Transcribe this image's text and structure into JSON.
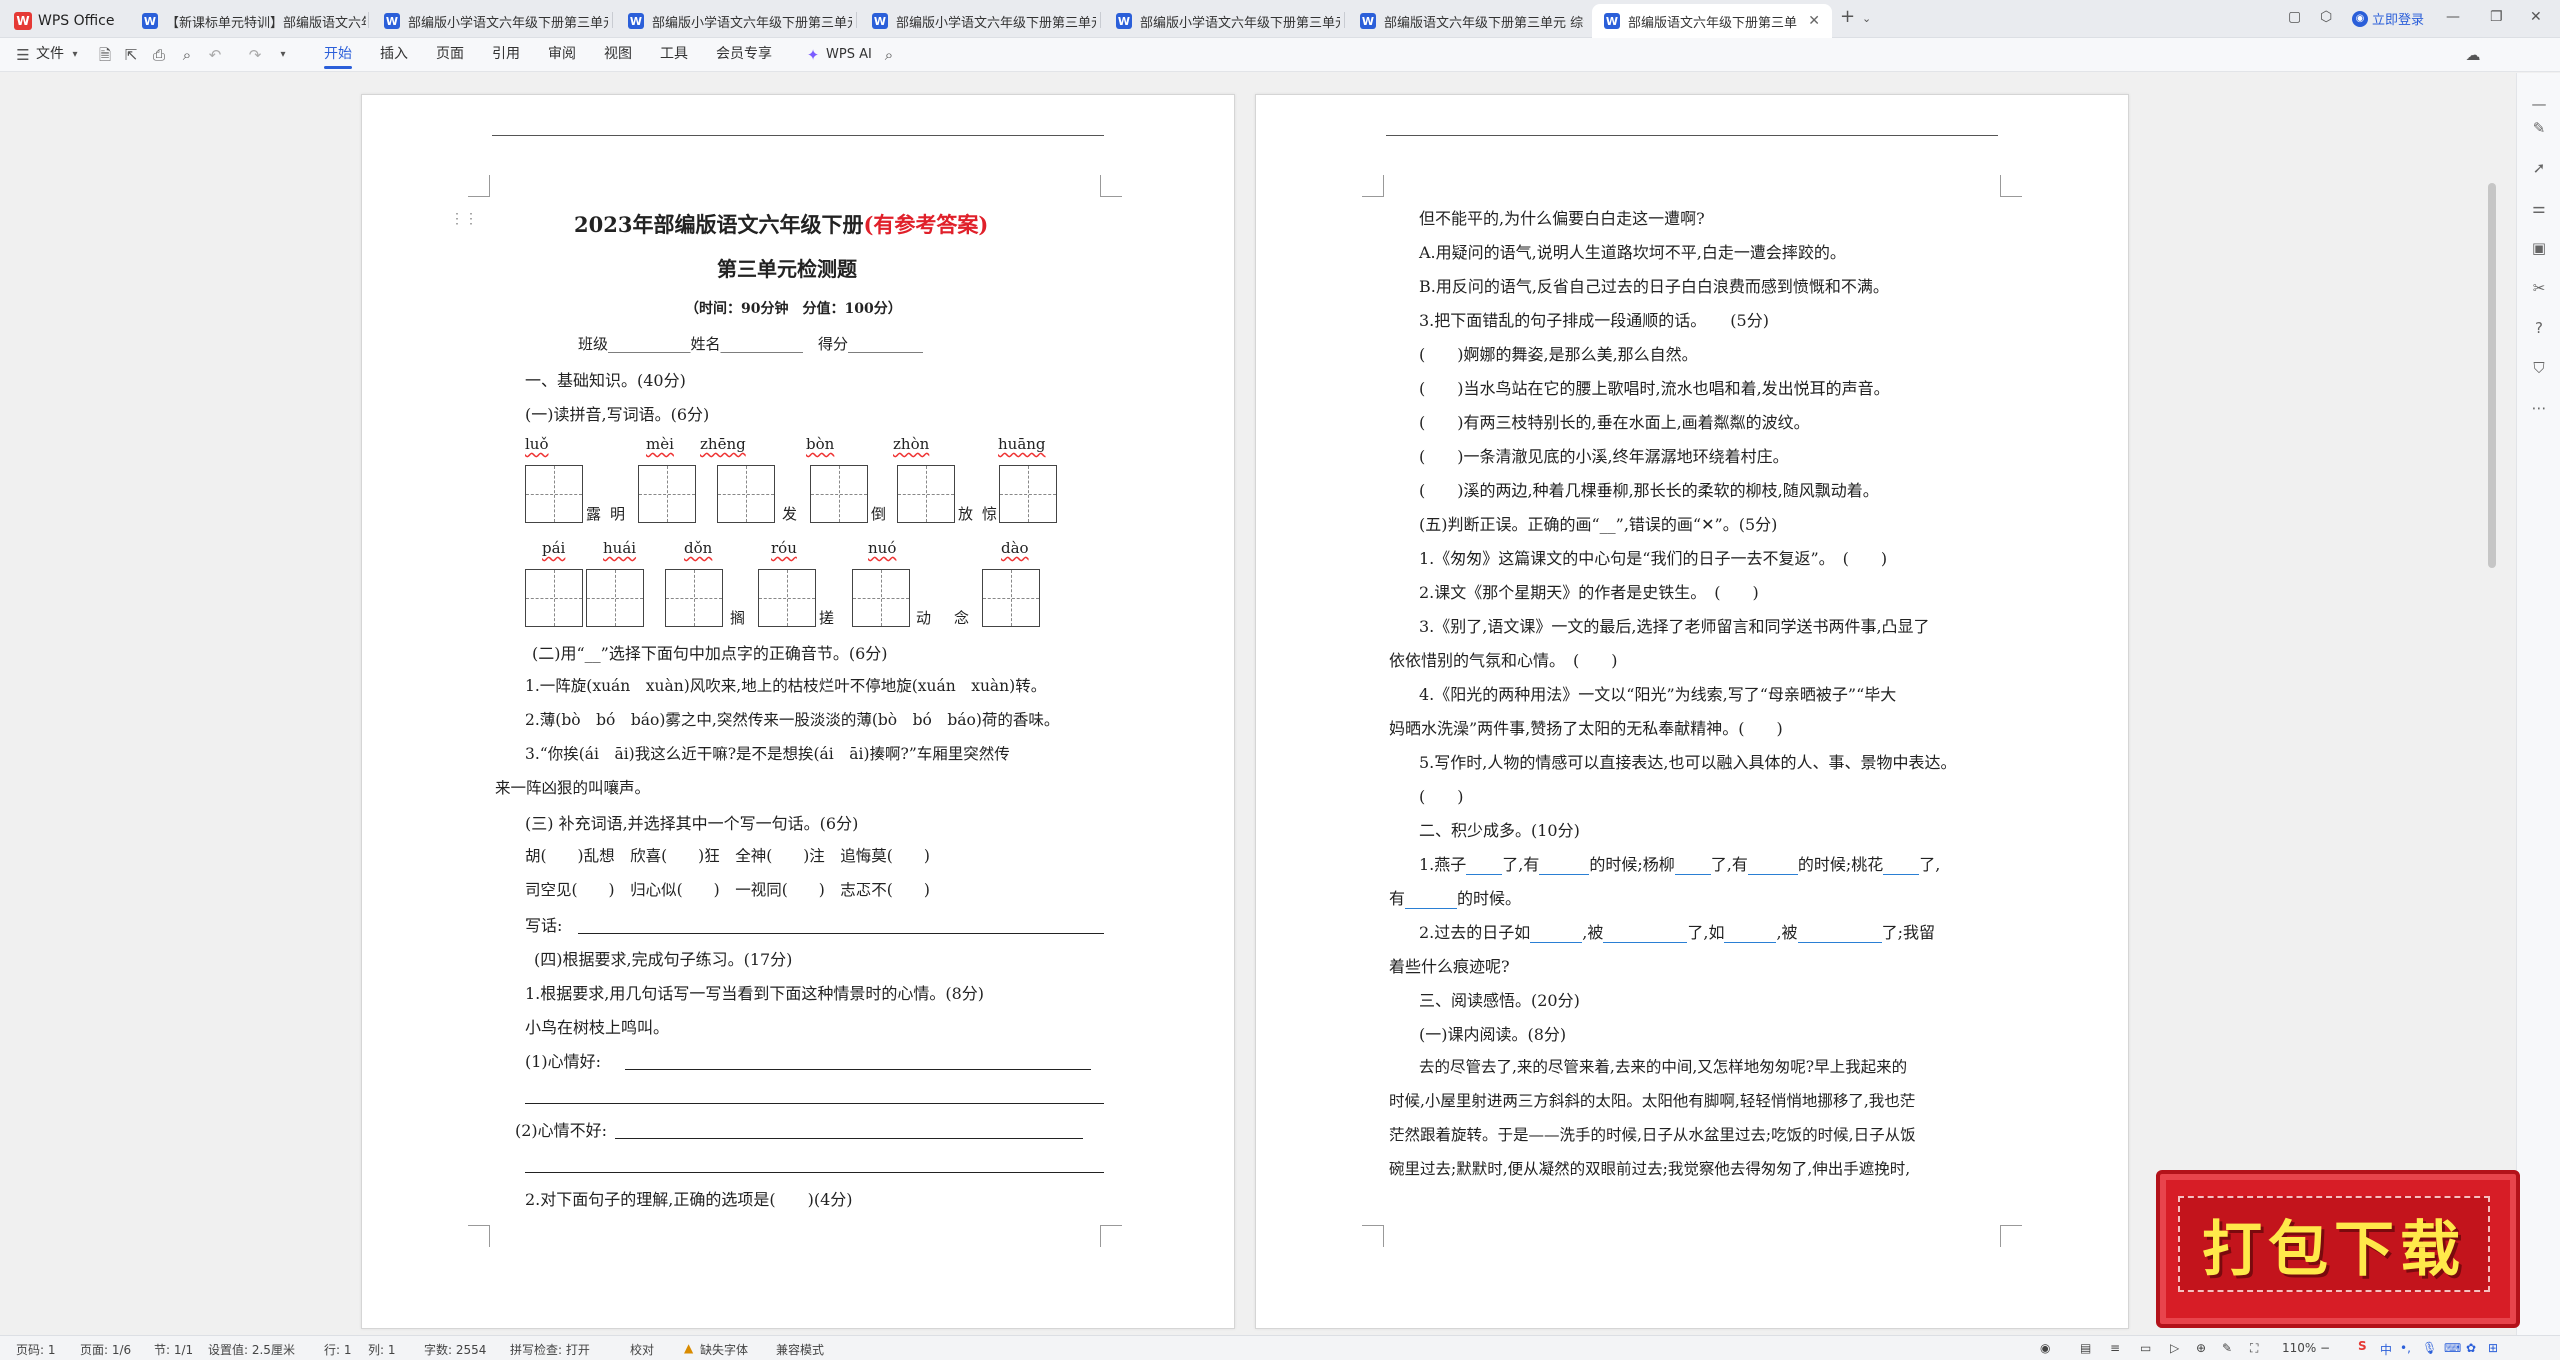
{
  "app": {
    "name": "WPS Office"
  },
  "tabs": [
    {
      "label": "【新课标单元特训】部编版语文六年"
    },
    {
      "label": "部编版小学语文六年级下册第三单元"
    },
    {
      "label": "部编版小学语文六年级下册第三单元"
    },
    {
      "label": "部编版小学语文六年级下册第三单元"
    },
    {
      "label": "部编版小学语文六年级下册第三单元"
    },
    {
      "label": "部编版语文六年级下册第三单元 综合"
    },
    {
      "label": "部编版语文六年级下册第三单"
    }
  ],
  "login": "立即登录",
  "share": "分享",
  "menu": {
    "file": "文件",
    "items": [
      "开始",
      "插入",
      "页面",
      "引用",
      "审阅",
      "视图",
      "工具",
      "会员专享"
    ],
    "ai": "WPS AI"
  },
  "page1": {
    "title_a": "2023年部编版语文六年级下册",
    "title_b": "(有参考答案)",
    "title2": "第三单元检测题",
    "time": "（时间：90分钟　分值：100分）",
    "class_line": "班级___________姓名___________　得分__________",
    "s1": "一、基础知识。(40分)",
    "s1a": "(一)读拼音,写词语。(6分)",
    "py_row1": [
      "luǒ",
      "mèi",
      "zhēng",
      "bòn",
      "zhòn",
      "huāng"
    ],
    "chars_row1": [
      "露",
      "明",
      "发",
      "倒",
      "放",
      "惊"
    ],
    "py_row2": [
      "pái",
      "huái",
      "dǒn",
      "róu",
      "nuó",
      "dào"
    ],
    "chars_row2": [
      "搁",
      "搓",
      "动",
      "念"
    ],
    "s1b": "(二)用“__”选择下面句中加点字的正确音节。(6分)",
    "q1": "1.一阵旋(xuán　xuàn)风吹来,地上的枯枝烂叶不停地旋(xuán　xuàn)转。",
    "q2": "2.薄(bò　bó　báo)雾之中,突然传来一股淡淡的薄(bò　bó　báo)荷的香味。",
    "q3a": "3.“你挨(ái　āi)我这么近干嘛?是不是想挨(ái　āi)揍啊?”车厢里突然传",
    "q3b": "来一阵凶狠的叫嚷声。",
    "s1c": "(三) 补充词语,并选择其中一个写一句话。(6分)",
    "w1": "胡(　　)乱想　欣喜(　　)狂　全神(　　)注　追悔莫(　　)",
    "w2": "司空见(　　)　归心似(　　)　一视同(　　)　志忑不(　　)",
    "write": "写话:",
    "s1d": "(四)根据要求,完成句子练习。(17分)",
    "q4": "1.根据要求,用几句话写一写当看到下面这种情景时的心情。(8分)",
    "q4s": "小鸟在树枝上鸣叫。",
    "q4a": "(1)心情好:",
    "q4b": "(2)心情不好:",
    "q5": "2.对下面句子的理解,正确的选项是(　　)(4分)"
  },
  "page2": {
    "l1": "但不能平的,为什么偏要白白走这一遭啊?",
    "l2": "A.用疑问的语气,说明人生道路坎坷不平,白走一遭会摔跤的。",
    "l3": "B.用反问的语气,反省自己过去的日子白白浪费而感到愤慨和不满。",
    "l4": "3.把下面错乱的句子排成一段通顺的话。　　(5分)",
    "l5": "(　　)婀娜的舞姿,是那么美,那么自然。",
    "l6": "(　　)当水鸟站在它的腰上歌唱时,流水也唱和着,发出悦耳的声音。",
    "l7": "(　　)有两三枝特别长的,垂在水面上,画着粼粼的波纹。",
    "l8": "(　　)一条清澈见底的小溪,终年潺潺地环绕着村庄。",
    "l9": "(　　)溪的两边,种着几棵垂柳,那长长的柔软的柳枝,随风飘动着。",
    "l10": "(五)判断正误。正确的画“__”,错误的画“✕”。(5分)",
    "l11": "1.《匆匆》这篇课文的中心句是“我们的日子一去不复返”。　(　　)",
    "l12": "2.课文《那个星期天》的作者是史铁生。　(　　)",
    "l13": "3.《别了,语文课》一文的最后,选择了老师留言和同学送书两件事,凸显了",
    "l14": "依依惜别的气氛和心情。　(　　)",
    "l15": "4.《阳光的两种用法》一文以“阳光”为线索,写了“母亲晒被子”“毕大",
    "l16": "妈晒水洗澡”两件事,赞扬了太阳的无私奉献精神。(　　)",
    "l17": "5.写作时,人物的情感可以直接表达,也可以融入具体的人、事、景物中表达。",
    "l18": "(　　)",
    "l19": "二、积少成多。(10分)",
    "l20a": "1.燕子",
    "l20b": "了,有",
    "l20c": "的时候;杨柳",
    "l20d": "了,有",
    "l20e": "的时候;桃花",
    "l20f": "了,",
    "l21a": "有",
    "l21b": "的时候。",
    "l22a": "2.过去的日子如",
    "l22b": ",被",
    "l22c": "了,如",
    "l22d": ",被",
    "l22e": "了;我留",
    "l23": "着些什么痕迹呢?",
    "l24": "三、阅读感悟。(20分)",
    "l25": "(一)课内阅读。(8分)",
    "l26": "去的尽管去了,来的尽管来着,去来的中间,又怎样地匆匆呢?早上我起来的",
    "l27": "时候,小屋里射进两三方斜斜的太阳。太阳他有脚啊,轻轻悄悄地挪移了,我也茫",
    "l28": "茫然跟着旋转。于是——洗手的时候,日子从水盆里过去;吃饭的时候,日子从饭",
    "l29": "碗里过去;默默时,便从凝然的双眼前过去;我觉察他去得匆匆了,伸出手遮挽时,"
  },
  "promo": "打包下载",
  "status": {
    "page": "页码: 1",
    "pages": "页面: 1/6",
    "section": "节: 1/1",
    "setting": "设置值: 2.5厘米",
    "row": "行: 1",
    "col": "列: 1",
    "words": "字数: 2554",
    "spell": "拼写检查: 打开",
    "proof": "校对",
    "font": "缺失字体",
    "compat": "兼容模式",
    "zoom": "110%"
  }
}
